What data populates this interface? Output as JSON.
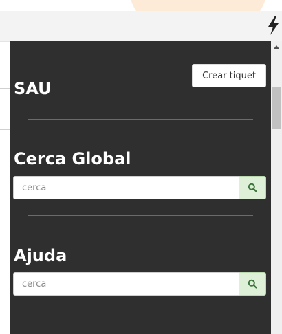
{
  "header": {
    "bolt_icon": "lightning-bolt-icon"
  },
  "sau": {
    "title": "SAU",
    "create_ticket_label": "Crear tiquet"
  },
  "global_search": {
    "title": "Cerca Global",
    "placeholder": "cerca",
    "button_icon": "search-icon"
  },
  "help": {
    "title": "Ajuda",
    "placeholder": "cerca",
    "button_icon": "search-icon"
  },
  "colors": {
    "panel": "#2f2f2f",
    "search_button": "#dff0d8",
    "search_icon": "#3c763d"
  }
}
